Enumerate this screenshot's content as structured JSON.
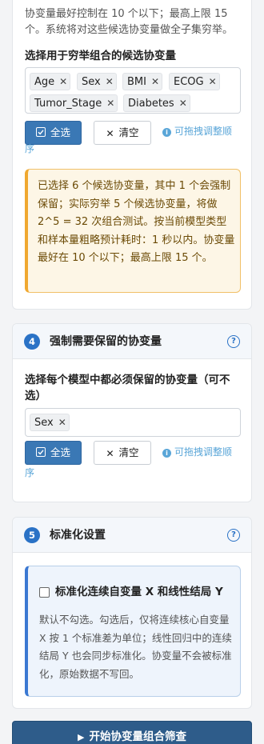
{
  "section3": {
    "intro": "协变量最好控制在 10 个以下；最高上限 15 个。系统将对这些候选协变量做全子集穷举。",
    "label": "选择用于穷举组合的候选协变量",
    "tags": [
      "Age",
      "Sex",
      "BMI",
      "ECOG",
      "Tumor_Stage",
      "Diabetes"
    ],
    "select_all": "全选",
    "clear": "清空",
    "hint_1": "可拖拽调整顺",
    "hint_2": "序",
    "warning": "已选择 6 个候选协变量，其中 1 个会强制保留；实际穷举 5 个候选协变量，将做 2^5 = 32 次组合测试。按当前模型类型和样本量粗略预计耗时：1 秒以内。协变量最好在 10 个以下；最高上限 15 个。"
  },
  "section4": {
    "number": "4",
    "title": "强制需要保留的协变量",
    "label": "选择每个模型中都必须保留的协变量（可不选）",
    "tags": [
      "Sex"
    ],
    "select_all": "全选",
    "clear": "清空",
    "hint_1": "可拖拽调整顺",
    "hint_2": "序"
  },
  "section5": {
    "number": "5",
    "title": "标准化设置",
    "checkbox_label": "标准化连续自变量 X 和线性结局 Y",
    "checked": false,
    "description": "默认不勾选。勾选后，仅将连续核心自变量 X 按 1 个标准差为单位；线性回归中的连续结局 Y 也会同步标准化。协变量不会被标准化，原始数据不写回。"
  },
  "run_button": "开始协变量组合筛查",
  "colors": {
    "primary": "#3a78b5",
    "accent": "#2a72c6",
    "warning_bg": "#fdf6e6",
    "warning_border": "#f0a830",
    "run": "#2e5c8a"
  }
}
